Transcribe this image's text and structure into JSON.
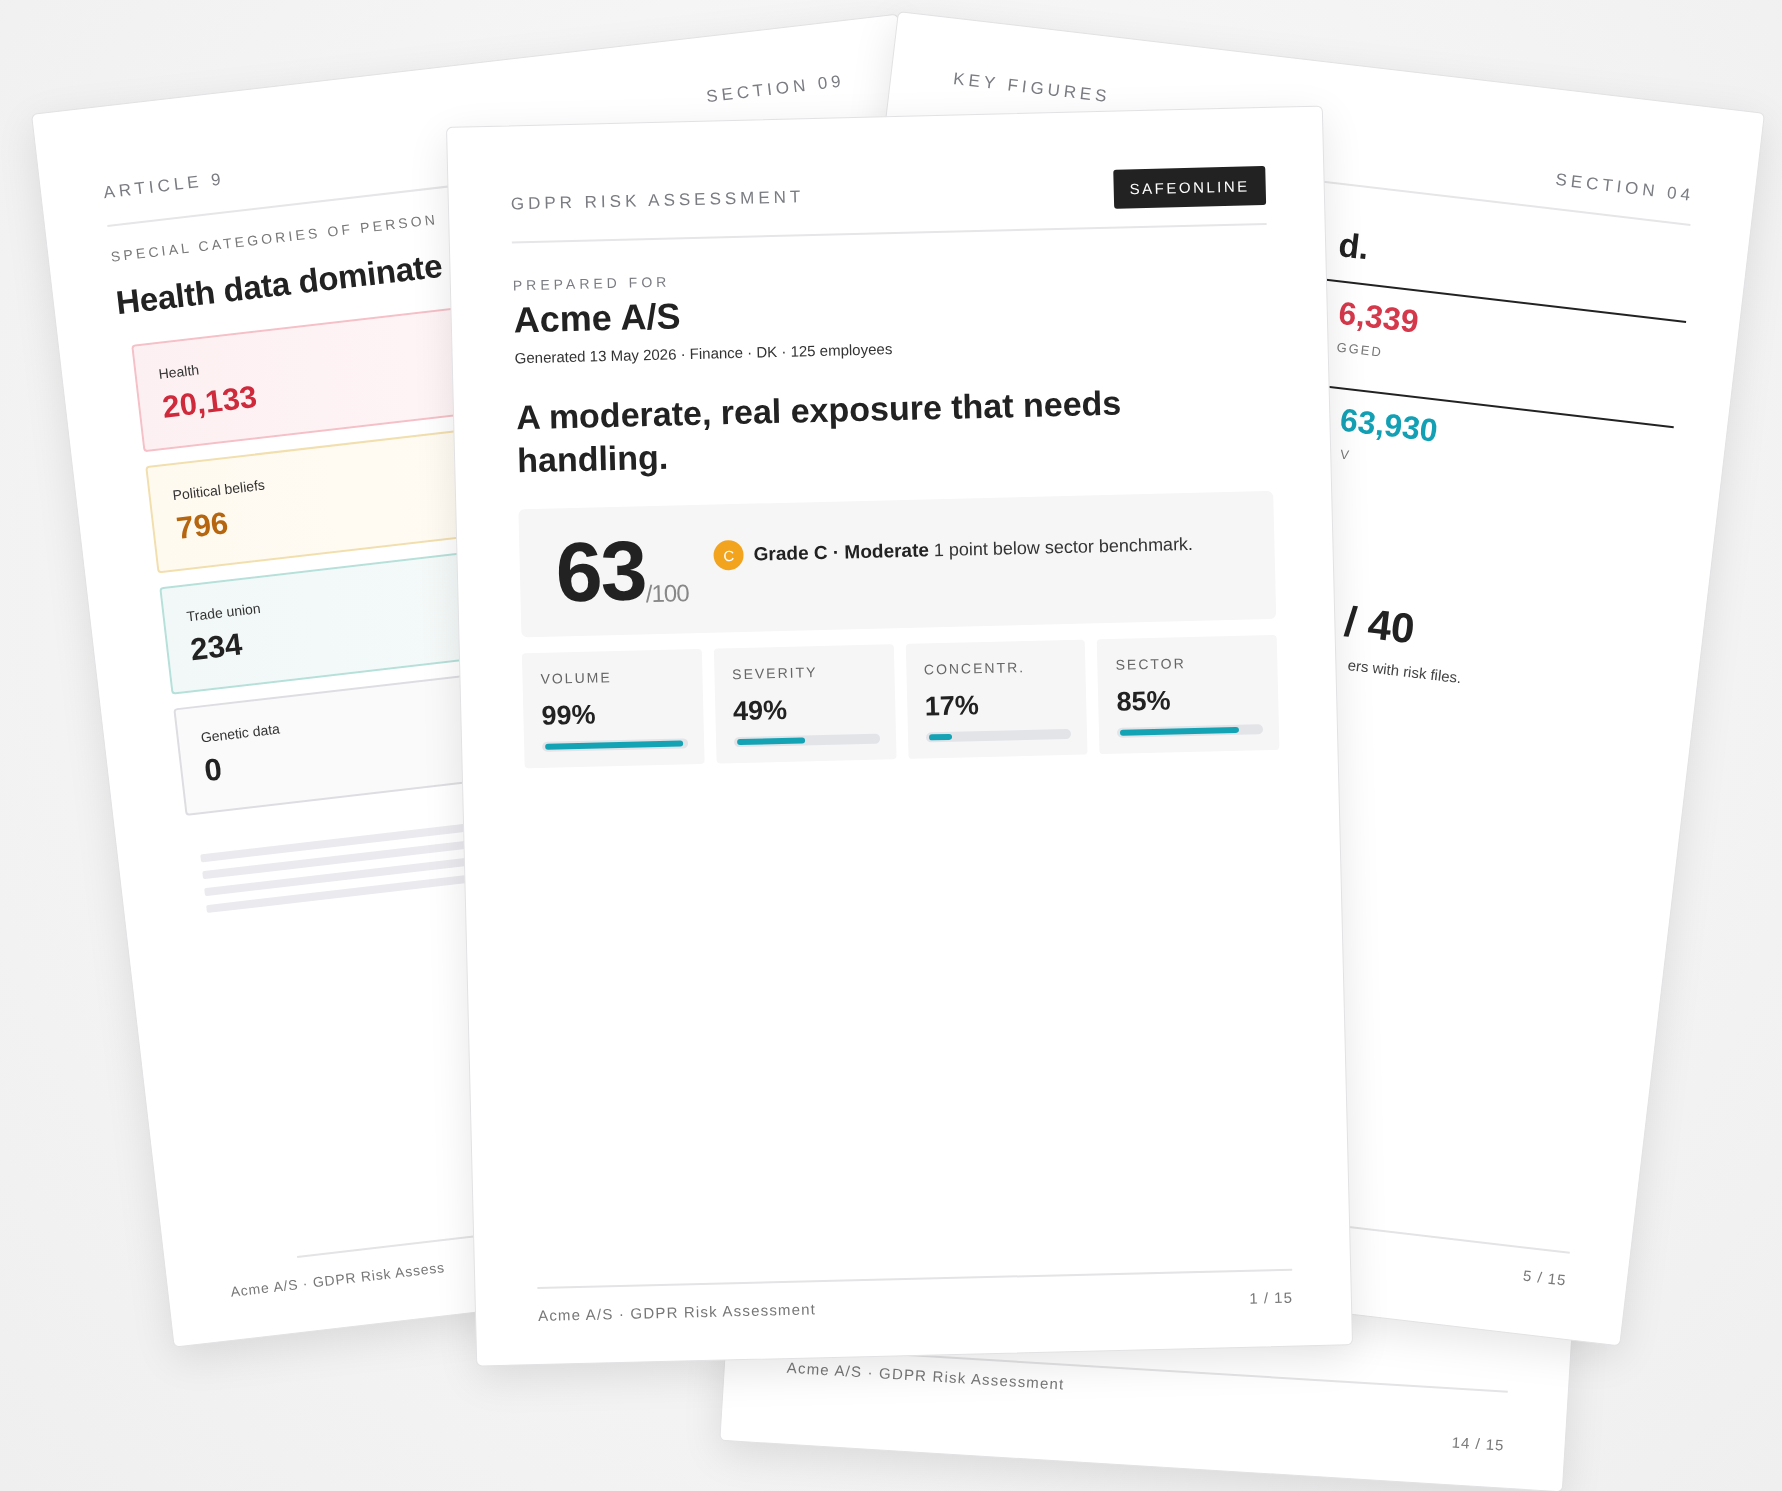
{
  "left_page": {
    "eyebrow": "ARTICLE 9",
    "section": "SECTION 09",
    "subtitle": "SPECIAL CATEGORIES OF PERSON",
    "heading": "Health data dominate",
    "categories": [
      {
        "label": "Health",
        "value": "20,133",
        "kind": "red"
      },
      {
        "label": "Political beliefs",
        "value": "796",
        "kind": "amber"
      },
      {
        "label": "Trade union",
        "value": "234",
        "kind": "teal"
      },
      {
        "label": "Genetic data",
        "value": "0",
        "kind": "neutral"
      }
    ],
    "footer": "Acme A/S · GDPR Risk Assess"
  },
  "right_page": {
    "eyebrow": "KEY FIGURES",
    "section": "SECTION 04",
    "heading": "d.",
    "figures": [
      {
        "value": "6,339",
        "caption": "GGED",
        "kind": "red"
      },
      {
        "value": "63,930",
        "caption": "V",
        "kind": "teal"
      }
    ],
    "ratio": "/ 40",
    "ratio_caption": "ers with risk files.",
    "page_number": "5 / 15"
  },
  "bottom_page": {
    "footer": "Acme A/S · GDPR Risk Assessment",
    "page_number": "14 / 15"
  },
  "front_page": {
    "eyebrow": "GDPR RISK ASSESSMENT",
    "brand": "SAFEONLINE",
    "prepared_label": "PREPARED FOR",
    "company": "Acme A/S",
    "meta": "Generated 13 May 2026 · Finance · DK · 125 employees",
    "headline": "A moderate, real exposure that needs handling.",
    "score": "63",
    "score_max": "/100",
    "grade_letter": "C",
    "grade_text": "**Grade C · Moderate** 1 point below sector benchmark.",
    "metrics": [
      {
        "label": "VOLUME",
        "value": "99%",
        "level": 0.99
      },
      {
        "label": "SEVERITY",
        "value": "49%",
        "level": 0.49
      },
      {
        "label": "CONCENTR.",
        "value": "17%",
        "level": 0.17
      },
      {
        "label": "SECTOR",
        "value": "85%",
        "level": 0.85
      }
    ],
    "footer": "Acme A/S · GDPR Risk Assessment",
    "page_number": "1 / 15"
  }
}
